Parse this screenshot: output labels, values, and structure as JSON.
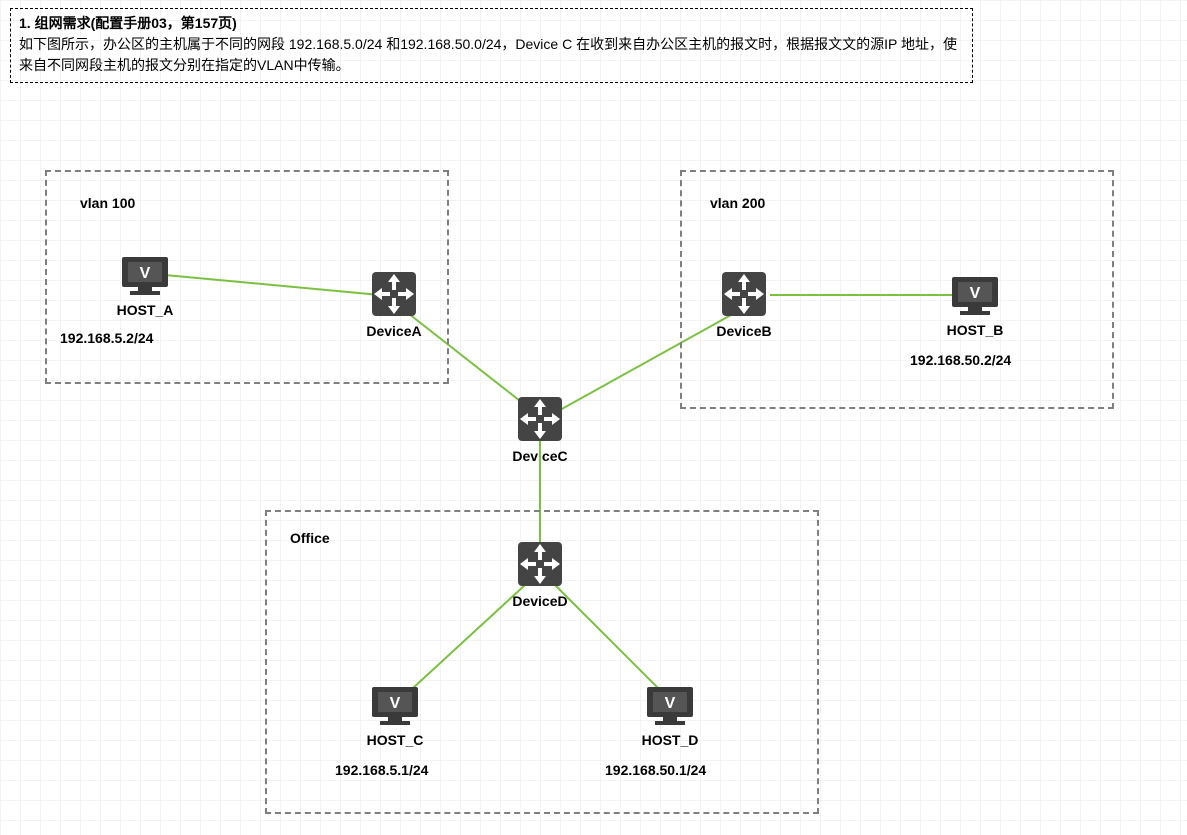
{
  "description": {
    "title": "1. 组网需求(配置手册03，第157页)",
    "body": "如下图所示，办公区的主机属于不同的网段 192.168.5.0/24 和192.168.50.0/24，Device C 在收到来自办公区主机的报文时，根据报文文的源IP 地址，使来自不同网段主机的报文分别在指定的VLAN中传输。"
  },
  "groups": {
    "vlan100": {
      "label": "vlan 100"
    },
    "vlan200": {
      "label": "vlan 200"
    },
    "office": {
      "label": "Office"
    }
  },
  "nodes": {
    "hostA": {
      "label": "HOST_A",
      "ip": "192.168.5.2/24"
    },
    "deviceA": {
      "label": "DeviceA"
    },
    "deviceB": {
      "label": "DeviceB"
    },
    "hostB": {
      "label": "HOST_B",
      "ip": "192.168.50.2/24"
    },
    "deviceC": {
      "label": "DeviceC"
    },
    "deviceD": {
      "label": "DeviceD"
    },
    "hostC": {
      "label": "HOST_C",
      "ip": "192.168.5.1/24"
    },
    "hostD": {
      "label": "HOST_D",
      "ip": "192.168.50.1/24"
    }
  },
  "links": [
    {
      "from": "hostA",
      "to": "deviceA"
    },
    {
      "from": "deviceA",
      "to": "deviceC"
    },
    {
      "from": "deviceB",
      "to": "hostB"
    },
    {
      "from": "deviceB",
      "to": "deviceC"
    },
    {
      "from": "deviceC",
      "to": "deviceD"
    },
    {
      "from": "deviceD",
      "to": "hostC"
    },
    {
      "from": "deviceD",
      "to": "hostD"
    }
  ]
}
